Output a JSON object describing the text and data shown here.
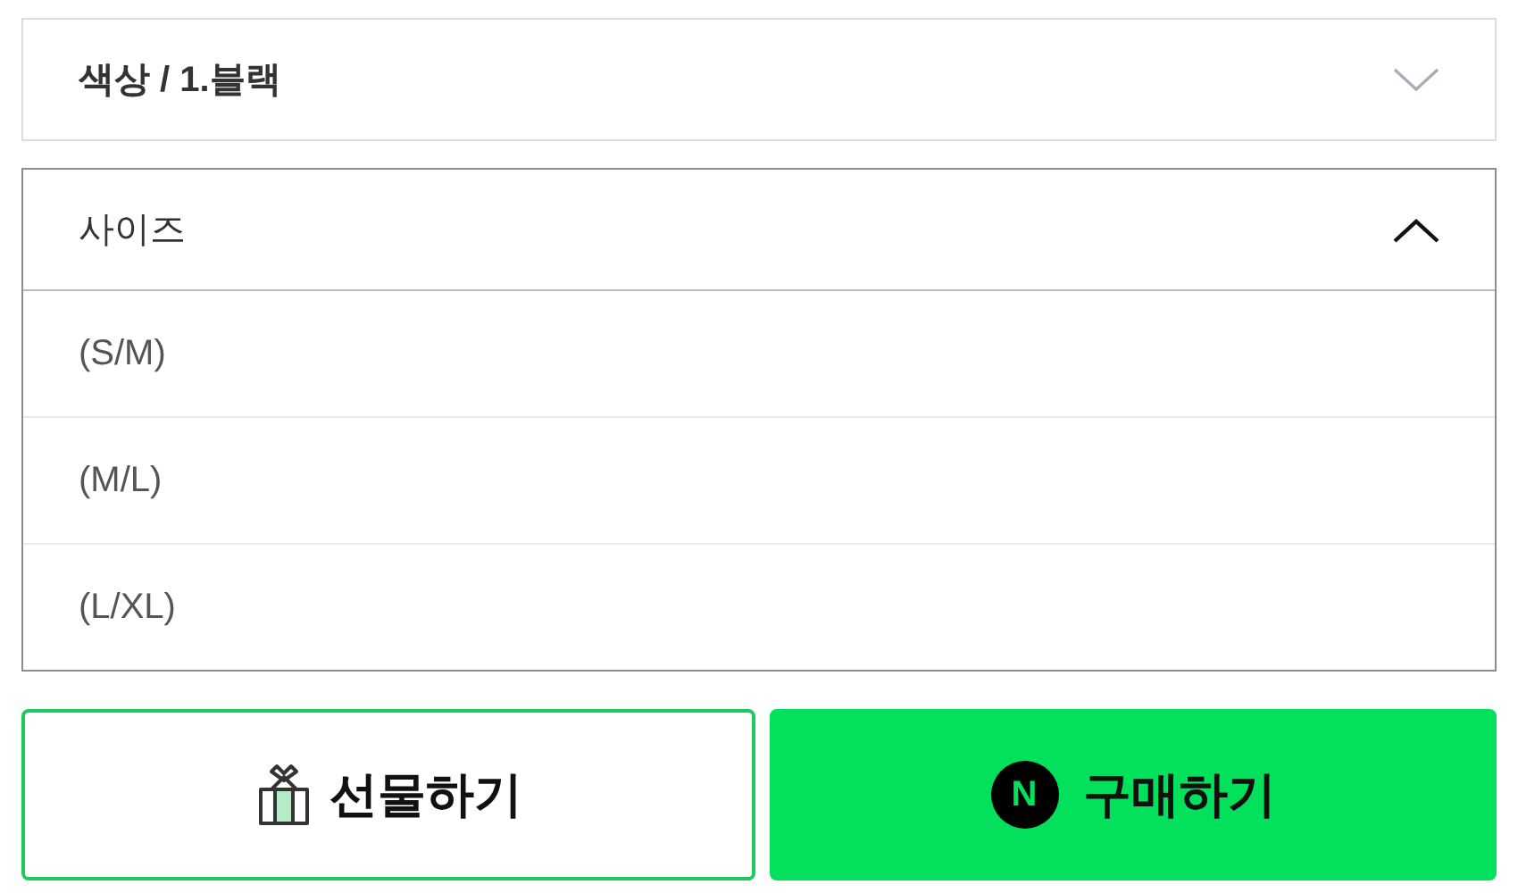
{
  "selects": [
    {
      "label": "색상 / 1.블랙",
      "expanded": false
    },
    {
      "label": "사이즈",
      "expanded": true,
      "options": [
        "(S/M)",
        "(M/L)",
        "(L/XL)"
      ]
    }
  ],
  "buttons": [
    {
      "kind": "gift",
      "label": "선물하기"
    },
    {
      "kind": "buy",
      "label": "구매하기",
      "badge": "N"
    }
  ]
}
